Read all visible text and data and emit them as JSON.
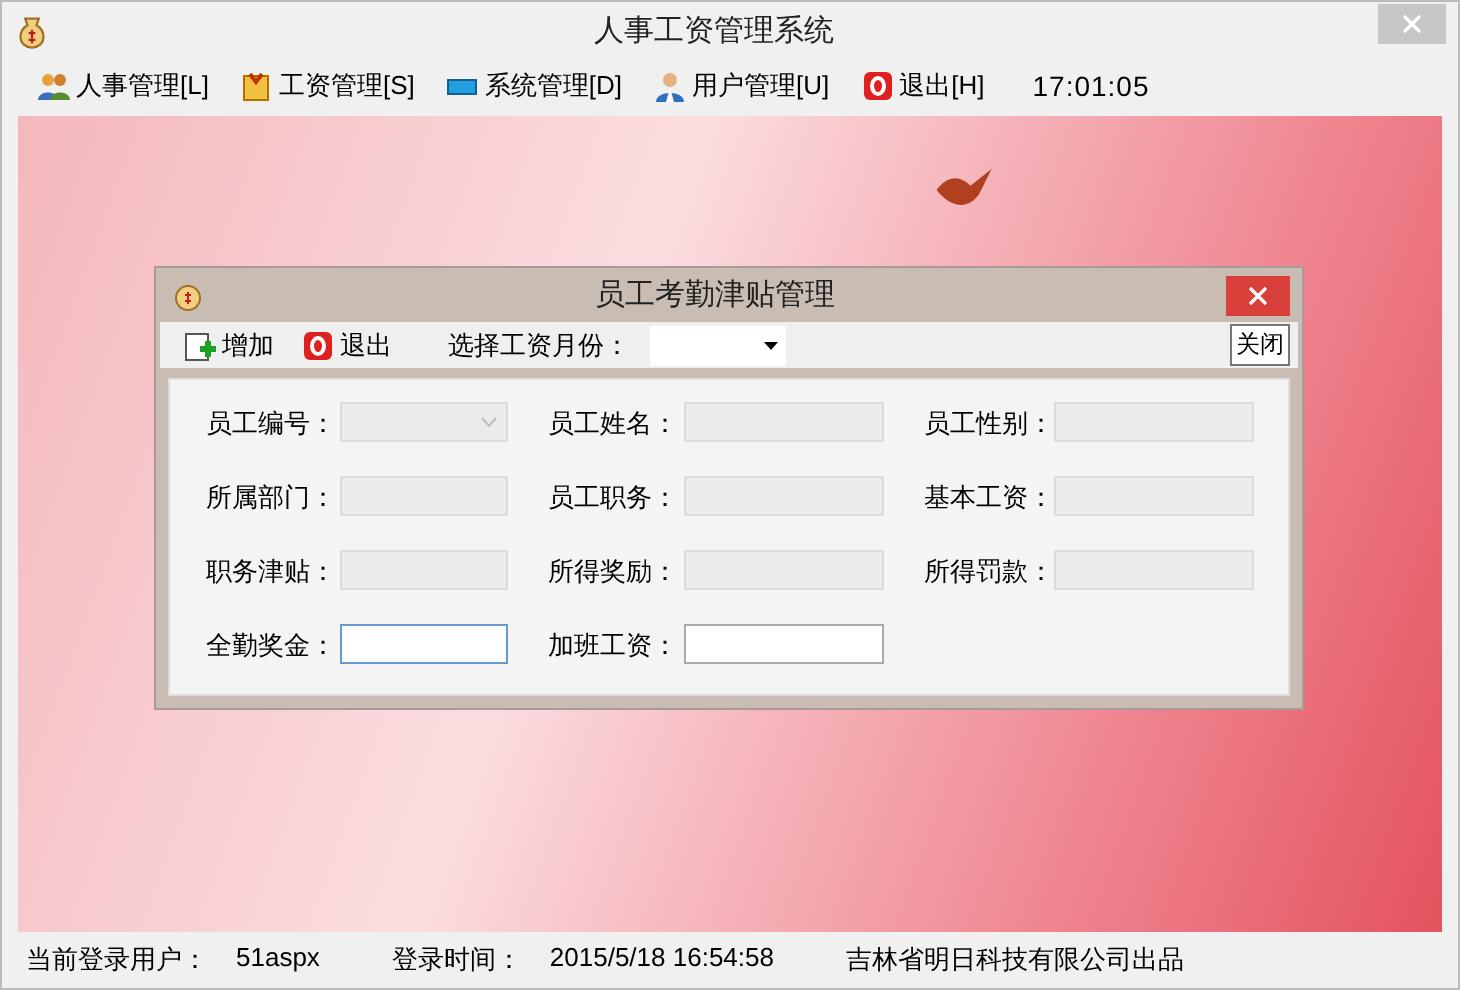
{
  "window": {
    "title": "人事工资管理系统"
  },
  "menu": [
    {
      "label": "人事管理[L]"
    },
    {
      "label": "工资管理[S]"
    },
    {
      "label": "系统管理[D]"
    },
    {
      "label": "用户管理[U]"
    },
    {
      "label": "退出[H]"
    }
  ],
  "clock": "17:01:05",
  "dialog": {
    "title": "员工考勤津贴管理",
    "toolbar": [
      {
        "label": "增加"
      },
      {
        "label": "退出"
      }
    ],
    "month_label": "选择工资月份：",
    "tooltip": "关闭",
    "fields": [
      {
        "label": "员工编号：",
        "kind": "combo",
        "disabled": true,
        "focused": false
      },
      {
        "label": "员工姓名：",
        "kind": "text",
        "disabled": true,
        "focused": false
      },
      {
        "label": "员工性别：",
        "kind": "text",
        "disabled": true,
        "focused": false
      },
      {
        "label": "所属部门：",
        "kind": "text",
        "disabled": true,
        "focused": false
      },
      {
        "label": "员工职务：",
        "kind": "text",
        "disabled": true,
        "focused": false
      },
      {
        "label": "基本工资：",
        "kind": "text",
        "disabled": true,
        "focused": false
      },
      {
        "label": "职务津贴：",
        "kind": "text",
        "disabled": true,
        "focused": false
      },
      {
        "label": "所得奖励：",
        "kind": "text",
        "disabled": true,
        "focused": false
      },
      {
        "label": "所得罚款：",
        "kind": "text",
        "disabled": true,
        "focused": false
      },
      {
        "label": "全勤奖金：",
        "kind": "text",
        "disabled": false,
        "focused": true
      },
      {
        "label": "加班工资：",
        "kind": "text",
        "disabled": false,
        "focused": false
      }
    ]
  },
  "status_bar": [
    {
      "label": "当前登录用户：",
      "value": "51aspx"
    },
    {
      "label": "登录时间：",
      "value": "2015/5/18 16:54:58"
    },
    {
      "label": "吉林省明日科技有限公司出品"
    }
  ]
}
